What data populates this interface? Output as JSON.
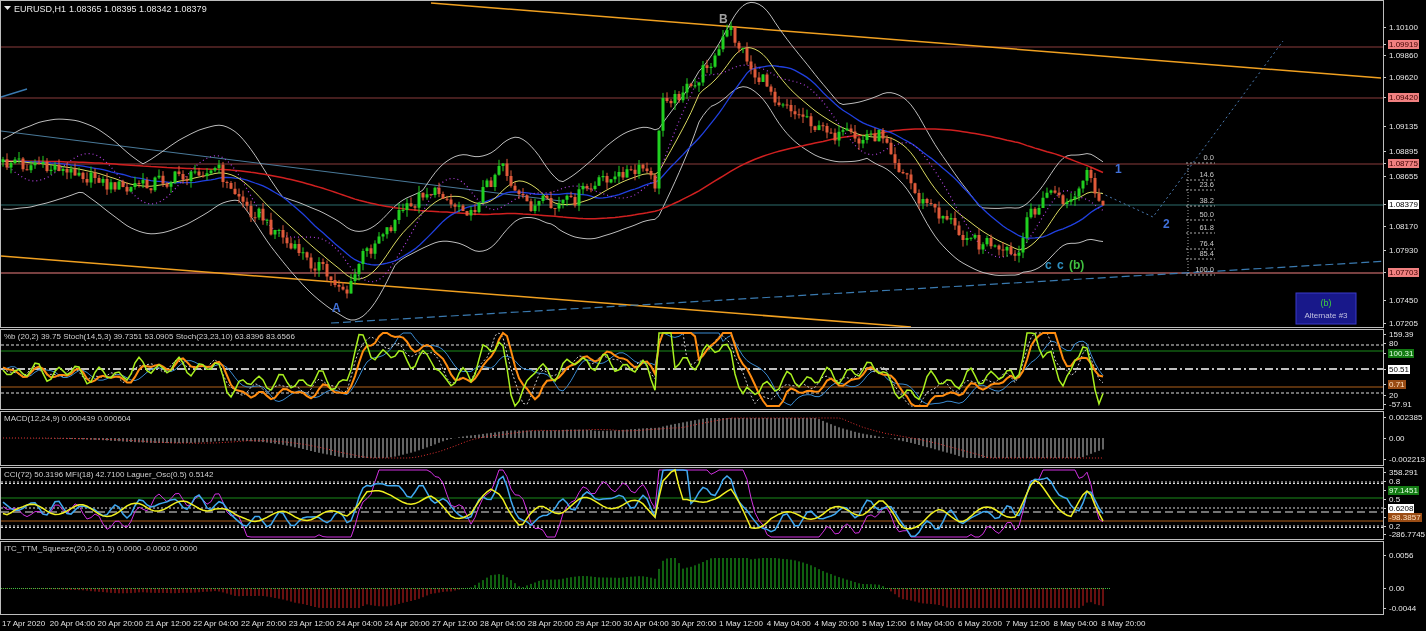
{
  "header": {
    "symbol": "EURUSD,H1",
    "ohlc": "1.08365 1.08395 1.08342 1.08379"
  },
  "main": {
    "price_axis": [
      {
        "text": "1.10100",
        "kind": "tick"
      },
      {
        "text": "1.09919",
        "kind": "level"
      },
      {
        "text": "1.09860",
        "kind": "tick"
      },
      {
        "text": "1.09620",
        "kind": "tick"
      },
      {
        "text": "1.09420",
        "kind": "level"
      },
      {
        "text": "1.09135",
        "kind": "tick"
      },
      {
        "text": "1.08895",
        "kind": "tick"
      },
      {
        "text": "1.08775",
        "kind": "level"
      },
      {
        "text": "1.08655",
        "kind": "tick"
      },
      {
        "text": "1.08379",
        "kind": "current"
      },
      {
        "text": "1.08170",
        "kind": "tick"
      },
      {
        "text": "1.07930",
        "kind": "tick"
      },
      {
        "text": "1.07703",
        "kind": "level"
      },
      {
        "text": "1.07450",
        "kind": "tick"
      },
      {
        "text": "1.07205",
        "kind": "tick"
      }
    ],
    "wave_labels": [
      {
        "text": "B",
        "color": "#a0a0a0"
      },
      {
        "text": "A",
        "color": "#4070d8"
      },
      {
        "text": "1",
        "color": "#4070d8"
      },
      {
        "text": "2",
        "color": "#4070d8"
      },
      {
        "text": "c",
        "color": "#3090c0"
      },
      {
        "text": "c",
        "color": "#3090c0"
      },
      {
        "text": "(b)",
        "color": "#40c040"
      }
    ],
    "fib_levels": [
      "0.0",
      "14.6",
      "23.6",
      "38.2",
      "50.0",
      "61.8",
      "76.4",
      "85.4",
      "100.0"
    ],
    "alternate_box": {
      "label": "(b)",
      "caption": "Alternate #3"
    }
  },
  "indicators": [
    {
      "title": "%b (20,2) 39.75 Stoch(14,5,3) 39.7351 53.0905 Stoch(23,23,10) 63.8396 83.6566",
      "axis": [
        {
          "text": "159.39",
          "kind": "tick"
        },
        {
          "text": "80",
          "kind": "tick"
        },
        {
          "text": "100.31",
          "kind": "green"
        },
        {
          "text": "50.51",
          "kind": "current"
        },
        {
          "text": "0.71",
          "kind": "brown"
        },
        {
          "text": "20",
          "kind": "tick"
        },
        {
          "text": "-57.91",
          "kind": "tick"
        }
      ]
    },
    {
      "title": "MACD(12,24,9) 0.000439 0.000604",
      "axis": [
        {
          "text": "0.002385",
          "kind": "tick"
        },
        {
          "text": "0.00",
          "kind": "tick"
        },
        {
          "text": "-0.002213",
          "kind": "tick"
        }
      ]
    },
    {
      "title": "CCI(72) 50.3196 MFI(18) 42.7100 Laguer_Osc(0.5) 0.5142",
      "axis": [
        {
          "text": "358.291",
          "kind": "tick"
        },
        {
          "text": "0.8",
          "kind": "tick"
        },
        {
          "text": "97.1451",
          "kind": "green"
        },
        {
          "text": "0.5",
          "kind": "tick"
        },
        {
          "text": "0.6208",
          "kind": "current"
        },
        {
          "text": "-98.3857",
          "kind": "brown"
        },
        {
          "text": "0.2",
          "kind": "tick"
        },
        {
          "text": "-286.7745",
          "kind": "tick"
        }
      ]
    },
    {
      "title": "ITC_TTM_Squeeze(20,2.0,1.5) 0.0000 -0.0002 0.0000",
      "axis": [
        {
          "text": "0.0056",
          "kind": "tick"
        },
        {
          "text": "0.00",
          "kind": "tick"
        },
        {
          "text": "-0.0044",
          "kind": "tick"
        }
      ]
    }
  ],
  "time_axis": [
    "17 Apr 2020",
    "20 Apr 04:00",
    "20 Apr 20:00",
    "21 Apr 12:00",
    "22 Apr 04:00",
    "22 Apr 20:00",
    "23 Apr 12:00",
    "24 Apr 04:00",
    "24 Apr 20:00",
    "27 Apr 12:00",
    "28 Apr 04:00",
    "28 Apr 20:00",
    "29 Apr 12:00",
    "30 Apr 04:00",
    "30 Apr 20:00",
    "1 May 12:00",
    "4 May 04:00",
    "4 May 20:00",
    "5 May 12:00",
    "6 May 04:00",
    "6 May 20:00",
    "7 May 12:00",
    "8 May 04:00",
    "8 May 20:00"
  ]
}
